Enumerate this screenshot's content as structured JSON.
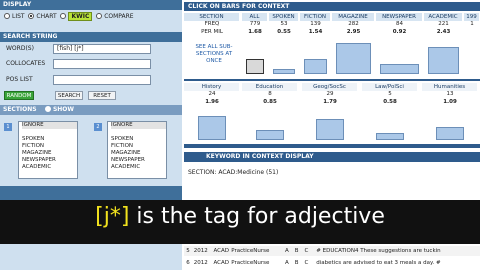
{
  "left": {
    "display_hdr": "DISPLAY",
    "display_options": [
      "LIST",
      "CHART",
      "KWIC",
      "COMPARE"
    ],
    "search_hdr": "SEARCH STRING",
    "words_label": "WORD(S)",
    "words_value": "[fish] [j*]",
    "collocates_label": "COLLOCATES",
    "pos_label": "POS LIST",
    "random_label": "RANDOM",
    "search_btn": "SEARCH",
    "reset_btn": "RESET",
    "sections_hdr": "SECTIONS",
    "show_label": "SHOW",
    "list1_num": "1",
    "list2_num": "2",
    "list1": [
      "IGNORE",
      "",
      "SPOKEN",
      "FICTION",
      "MAGAZINE",
      "NEWSPAPER",
      "ACADEMIC"
    ],
    "list2": [
      "IGNORE",
      "",
      "SPOKEN",
      "FICTION",
      "MAGAZINE",
      "NEWSPAPER",
      "ACADEMIC"
    ]
  },
  "right": {
    "click_hdr": "CLICK ON BARS FOR CONTEXT",
    "col_headers": [
      "SECTION",
      "ALL",
      "SPOKEN",
      "FICTION",
      "MAGAZINE",
      "NEWSPAPER",
      "ACADEMIC",
      "199"
    ],
    "freq_label": "FREQ",
    "freq": [
      "779",
      "53",
      "139",
      "282",
      "84",
      "221",
      "1"
    ],
    "permil_label": "PER MIL",
    "permil": [
      "1.68",
      "0.55",
      "1.54",
      "2.95",
      "0.92",
      "2.43",
      ""
    ],
    "see_all": "SEE ALL SUB-SECTIONS AT ONCE",
    "bars_top": [
      0.45,
      0.15,
      0.43,
      0.9,
      0.3,
      0.8
    ],
    "sub_headers": [
      "History",
      "Education",
      "Geog/SocSc",
      "Law/PolSci",
      "Humanities"
    ],
    "sub_freq": [
      "24",
      "8",
      "29",
      "5",
      "13"
    ],
    "sub_permil": [
      "1.96",
      "0.85",
      "1.79",
      "0.58",
      "1.09"
    ],
    "kwic_hdr": "KEYWORD IN CONTEXT DISPLAY",
    "section_label": "SECTION: ACAD:Medicine (51)",
    "rows": [
      {
        "n": "5",
        "year": "2012",
        "sec": "ACAD",
        "src": "PracticeNurse",
        "a": "A",
        "b": "B",
        "c": "C",
        "text": "# EDUCATION4 These suggestions are tuckin"
      },
      {
        "n": "6",
        "year": "2012",
        "sec": "ACAD",
        "src": "PracticeNurse",
        "a": "A",
        "b": "B",
        "c": "C",
        "text": "diabetics are advised to eat 3 meals a day. #"
      }
    ]
  },
  "caption": {
    "tag": "[j*]",
    "rest": " is the tag for adjective"
  }
}
